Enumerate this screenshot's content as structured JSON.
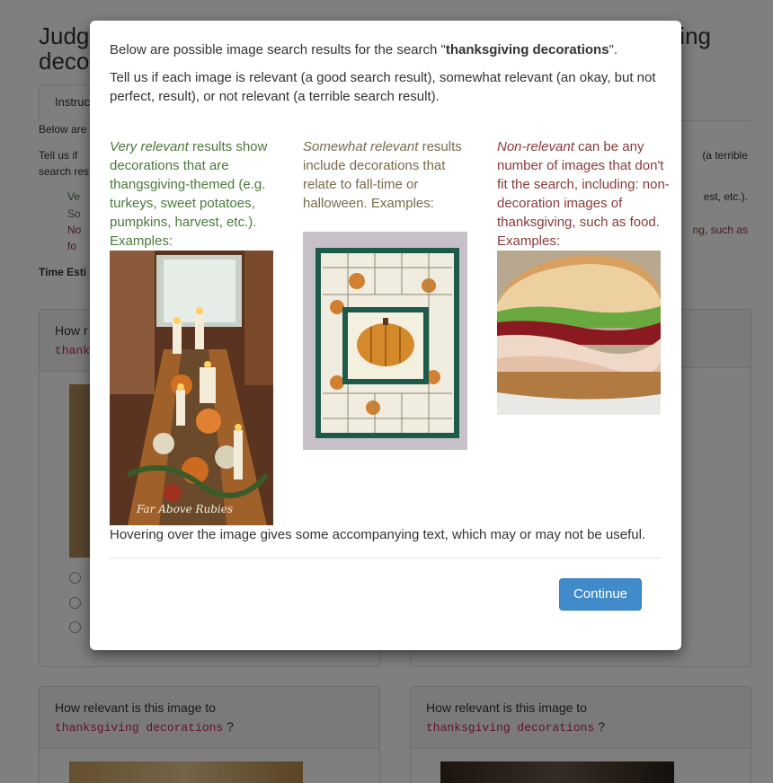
{
  "background": {
    "title_left_line1": "Judg",
    "title_left_line2": "deco",
    "title_right": "ing",
    "tab_instructions": "Instruc",
    "text_below": "Below are",
    "text_tell_left": "Tell us if",
    "text_tell_right": "(a terrible",
    "text_search_res": "search res",
    "list_left": [
      "Ve",
      "So",
      "No",
      "fo"
    ],
    "list_right": [
      "est, etc.).",
      "ng, such as"
    ],
    "time_est": "Time Esti",
    "panel_top_left": {
      "q": "How r",
      "code": "thank"
    },
    "panels_bottom": [
      {
        "question": "How relevant is this image to",
        "query": "thanksgiving decorations",
        "suffix": "?"
      },
      {
        "question": "How relevant is this image to",
        "query": "thanksgiving decorations",
        "suffix": "?"
      }
    ]
  },
  "modal": {
    "intro_prefix": "Below are possible image search results for the search \"",
    "intro_query": "thanksgiving decorations",
    "intro_suffix": "\".",
    "instructions": "Tell us if each image is relevant (a good search result), somewhat relevant (an okay, but not perfect, result), or not relevant (a terrible search result).",
    "columns": [
      {
        "heading": "Very relevant",
        "body": " results show decorations that are thangsgiving-themed (e.g. turkeys, sweet potatoes, pumpkins, harvest, etc.). Examples:",
        "image_caption": "Far Above Rubies",
        "color": "#4a7a3a"
      },
      {
        "heading": "Somewhat relevant",
        "body": " results include decorations that relate to fall-time or halloween. Examples:",
        "color": "#7a6a4a"
      },
      {
        "heading": "Non-relevant",
        "body": " can be any number of images that don't fit the search, including: non-decoration images of thanksgiving, such as food. Examples:",
        "color": "#8a3a3a"
      }
    ],
    "hover_note": "Hovering over the image gives some accompanying text, which may or may not be useful.",
    "continue_label": "Continue"
  },
  "colors": {
    "primary": "#428bca",
    "query_code": "#c7254e",
    "overlay": "rgba(0,0,0,0.5)"
  }
}
